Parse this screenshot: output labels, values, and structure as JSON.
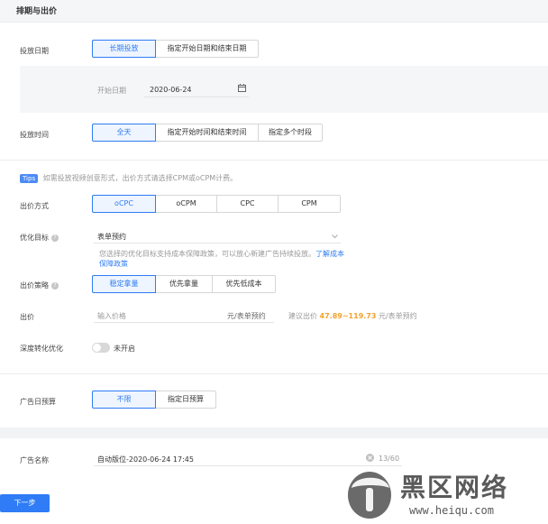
{
  "section_title": "排期与出价",
  "schedule": {
    "date_label": "投放日期",
    "date_options": [
      "长期投放",
      "指定开始日期和结束日期"
    ],
    "start_date_label": "开始日期",
    "start_date_value": "2020-06-24",
    "time_label": "投放时间",
    "time_options": [
      "全天",
      "指定开始时间和结束时间",
      "指定多个时段"
    ]
  },
  "bidding": {
    "tips_badge": "Tips",
    "tips_text": "如需投放视频创意形式，出价方式请选择CPM或oCPM计费。",
    "method_label": "出价方式",
    "method_options": [
      "oCPC",
      "oCPM",
      "CPC",
      "CPM"
    ],
    "goal_label": "优化目标",
    "goal_value": "表单预约",
    "goal_hint": "您选择的优化目标支持成本保障政策，可以放心新建广告持续投放。",
    "goal_link": "了解成本保障政策",
    "strategy_label": "出价策略",
    "strategy_options": [
      "稳定拿量",
      "优先拿量",
      "优先低成本"
    ],
    "bid_label": "出价",
    "bid_placeholder": "输入价格",
    "bid_unit": "元/表单预约",
    "suggest_prefix": "建议出价",
    "suggest_range": "47.89~119.73",
    "suggest_unit": "元/表单预约",
    "deep_label": "深度转化优化",
    "deep_status": "未开启"
  },
  "budget": {
    "label": "广告日预算",
    "options": [
      "不限",
      "指定日预算"
    ]
  },
  "ad_name": {
    "label": "广告名称",
    "value": "自动版位-2020-06-24 17:45",
    "counter": "13/60"
  },
  "next_button": "下一步",
  "watermark": {
    "text": "黑区网络",
    "url": "www.heiqu.com"
  },
  "colors": {
    "accent": "#2f7cf6",
    "suggest": "#f4a22d"
  }
}
